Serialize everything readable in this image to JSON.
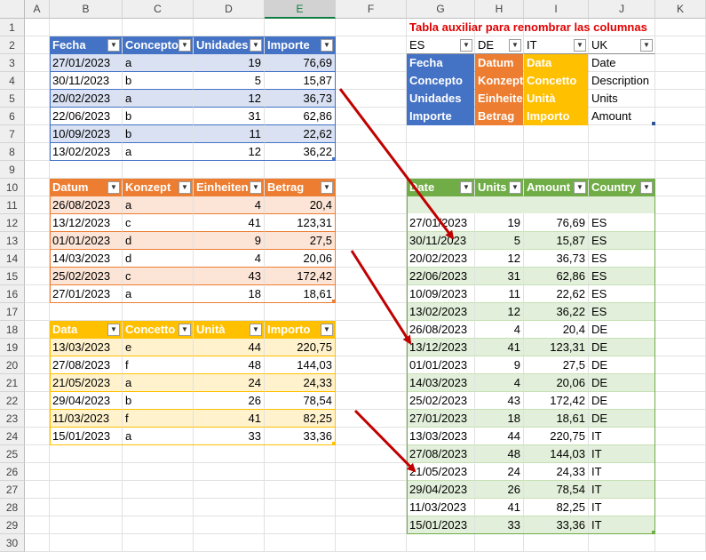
{
  "column_headers": [
    "A",
    "B",
    "C",
    "D",
    "E",
    "F",
    "G",
    "H",
    "I",
    "J",
    "K"
  ],
  "row_numbers": [
    "1",
    "2",
    "3",
    "4",
    "5",
    "6",
    "7",
    "8",
    "9",
    "10",
    "11",
    "12",
    "13",
    "14",
    "15",
    "16",
    "17",
    "18",
    "19",
    "20",
    "21",
    "22",
    "23",
    "24",
    "25",
    "26",
    "27",
    "28",
    "29",
    "30"
  ],
  "colors": {
    "blue_header": "#4472c4",
    "blue_band": "#d9e1f2",
    "orange_header": "#ed7d31",
    "orange_band": "#fce4d6",
    "gold_header": "#ffc000",
    "gold_band": "#fff2cc",
    "green_header": "#70ad47",
    "green_band": "#e2efda",
    "arrow": "#c00000",
    "aux_title": "#e00000"
  },
  "tables": {
    "es": {
      "headers": [
        "Fecha",
        "Concepto",
        "Unidades",
        "Importe"
      ],
      "rows": [
        [
          "27/01/2023",
          "a",
          "19",
          "76,69"
        ],
        [
          "30/11/2023",
          "b",
          "5",
          "15,87"
        ],
        [
          "20/02/2023",
          "a",
          "12",
          "36,73"
        ],
        [
          "22/06/2023",
          "b",
          "31",
          "62,86"
        ],
        [
          "10/09/2023",
          "b",
          "11",
          "22,62"
        ],
        [
          "13/02/2023",
          "a",
          "12",
          "36,22"
        ]
      ]
    },
    "de": {
      "headers": [
        "Datum",
        "Konzept",
        "Einheiten",
        "Betrag"
      ],
      "rows": [
        [
          "26/08/2023",
          "a",
          "4",
          "20,4"
        ],
        [
          "13/12/2023",
          "c",
          "41",
          "123,31"
        ],
        [
          "01/01/2023",
          "d",
          "9",
          "27,5"
        ],
        [
          "14/03/2023",
          "d",
          "4",
          "20,06"
        ],
        [
          "25/02/2023",
          "c",
          "43",
          "172,42"
        ],
        [
          "27/01/2023",
          "a",
          "18",
          "18,61"
        ]
      ]
    },
    "it": {
      "headers": [
        "Data",
        "Concetto",
        "Unità",
        "Importo"
      ],
      "rows": [
        [
          "13/03/2023",
          "e",
          "44",
          "220,75"
        ],
        [
          "27/08/2023",
          "f",
          "48",
          "144,03"
        ],
        [
          "21/05/2023",
          "a",
          "24",
          "24,33"
        ],
        [
          "29/04/2023",
          "b",
          "26",
          "78,54"
        ],
        [
          "11/03/2023",
          "f",
          "41",
          "82,25"
        ],
        [
          "15/01/2023",
          "a",
          "33",
          "33,36"
        ]
      ]
    },
    "aux": {
      "title": "Tabla auxiliar para renombrar las columnas",
      "headers": [
        "ES",
        "DE",
        "IT",
        "UK"
      ],
      "rows": [
        [
          "Fecha",
          "Datum",
          "Data",
          "Date"
        ],
        [
          "Concepto",
          "Konzept",
          "Concetto",
          "Description"
        ],
        [
          "Unidades",
          "Einheite",
          "Unità",
          "Units"
        ],
        [
          "Importe",
          "Betrag",
          "Importo",
          "Amount"
        ]
      ]
    },
    "combined": {
      "headers": [
        "Date",
        "Units",
        "Amount",
        "Country"
      ],
      "rows": [
        [
          "27/01/2023",
          "19",
          "76,69",
          "ES"
        ],
        [
          "30/11/2023",
          "5",
          "15,87",
          "ES"
        ],
        [
          "20/02/2023",
          "12",
          "36,73",
          "ES"
        ],
        [
          "22/06/2023",
          "31",
          "62,86",
          "ES"
        ],
        [
          "10/09/2023",
          "11",
          "22,62",
          "ES"
        ],
        [
          "13/02/2023",
          "12",
          "36,22",
          "ES"
        ],
        [
          "26/08/2023",
          "4",
          "20,4",
          "DE"
        ],
        [
          "13/12/2023",
          "41",
          "123,31",
          "DE"
        ],
        [
          "01/01/2023",
          "9",
          "27,5",
          "DE"
        ],
        [
          "14/03/2023",
          "4",
          "20,06",
          "DE"
        ],
        [
          "25/02/2023",
          "43",
          "172,42",
          "DE"
        ],
        [
          "27/01/2023",
          "18",
          "18,61",
          "DE"
        ],
        [
          "13/03/2023",
          "44",
          "220,75",
          "IT"
        ],
        [
          "27/08/2023",
          "48",
          "144,03",
          "IT"
        ],
        [
          "21/05/2023",
          "24",
          "24,33",
          "IT"
        ],
        [
          "29/04/2023",
          "26",
          "78,54",
          "IT"
        ],
        [
          "11/03/2023",
          "41",
          "82,25",
          "IT"
        ],
        [
          "15/01/2023",
          "33",
          "33,36",
          "IT"
        ]
      ]
    }
  }
}
